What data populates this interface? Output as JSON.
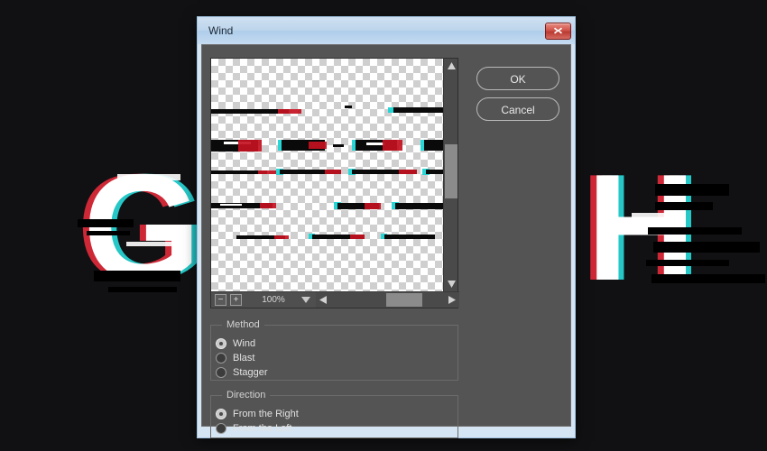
{
  "background": {
    "color": "#111113",
    "letters": [
      {
        "char": "G",
        "name": "glitch-letter-g"
      },
      {
        "char": "H",
        "name": "glitch-letter-h"
      }
    ]
  },
  "dialog": {
    "title": "Wind",
    "close_icon": "close-x-icon",
    "buttons": {
      "ok_label": "OK",
      "cancel_label": "Cancel"
    },
    "preview": {
      "zoom_value": "100%",
      "zoom_out_label": "−",
      "zoom_in_label": "+",
      "dropdown_icon": "chevron-down-icon",
      "scroll_up_icon": "triangle-up-icon",
      "scroll_down_icon": "triangle-down-icon",
      "scroll_left_icon": "triangle-left-icon",
      "scroll_right_icon": "triangle-right-icon"
    },
    "method": {
      "legend": "Method",
      "options": [
        {
          "label": "Wind",
          "selected": true
        },
        {
          "label": "Blast",
          "selected": false
        },
        {
          "label": "Stagger",
          "selected": false
        }
      ]
    },
    "direction": {
      "legend": "Direction",
      "options": [
        {
          "label": "From the Right",
          "selected": true
        },
        {
          "label": "From the Left",
          "selected": false
        }
      ]
    }
  },
  "colors": {
    "titlebar_accent": "#bed5ec",
    "close_button": "#c4483f",
    "dialog_body": "#545454",
    "chroma_red": "#e01b2a",
    "chroma_cyan": "#18e6e6"
  }
}
